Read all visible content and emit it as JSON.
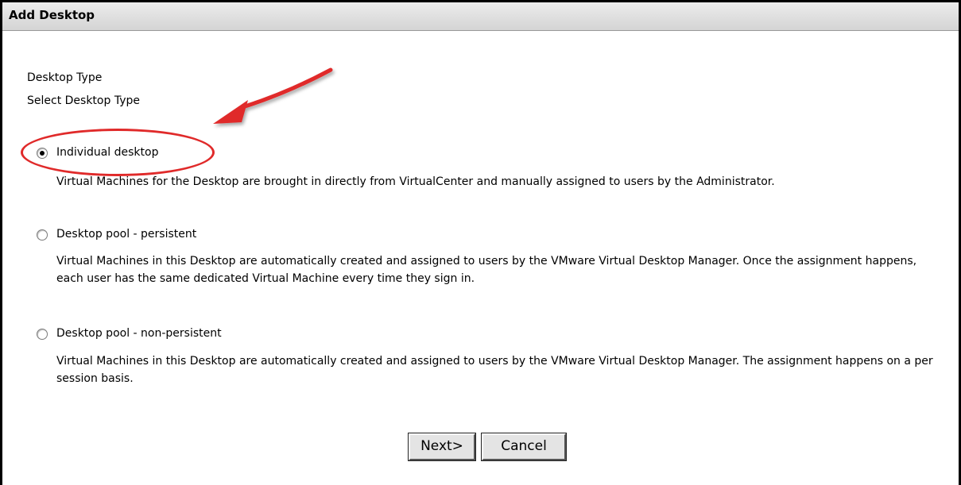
{
  "window": {
    "title": "Add Desktop"
  },
  "section": {
    "heading": "Desktop Type",
    "subheading": "Select Desktop Type"
  },
  "options": [
    {
      "label": "Individual desktop",
      "selected": true,
      "description": "Virtual Machines for the Desktop are brought in directly from VirtualCenter and manually assigned to users by the Administrator."
    },
    {
      "label": "Desktop pool - persistent",
      "selected": false,
      "description": "Virtual Machines in this Desktop are automatically created and assigned to users by the VMware Virtual Desktop Manager. Once the assignment happens, each user has the same dedicated Virtual Machine every time they sign in."
    },
    {
      "label": "Desktop pool - non-persistent",
      "selected": false,
      "description": "Virtual Machines in this Desktop are automatically created and assigned to users by the VMware Virtual Desktop Manager. The assignment happens on a per session basis."
    }
  ],
  "buttons": {
    "next": "Next>",
    "cancel": "Cancel"
  },
  "annotation": {
    "color": "#e02a2a"
  }
}
